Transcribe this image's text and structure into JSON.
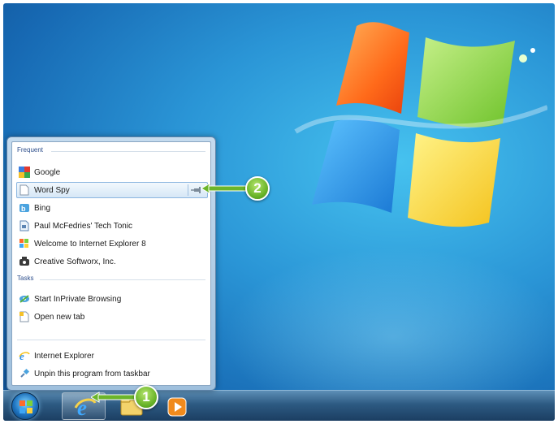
{
  "jumplist": {
    "frequent_header": "Frequent",
    "frequent": [
      {
        "label": "Google",
        "icon": "google-icon"
      },
      {
        "label": "Word Spy",
        "icon": "page-icon",
        "hovered": true
      },
      {
        "label": "Bing",
        "icon": "bing-icon"
      },
      {
        "label": "Paul McFedries' Tech Tonic",
        "icon": "page-icon"
      },
      {
        "label": "Welcome to Internet Explorer 8",
        "icon": "windows-flag-icon"
      },
      {
        "label": "Creative Softworx, Inc.",
        "icon": "creative-softworx-icon"
      }
    ],
    "tasks_header": "Tasks",
    "tasks": [
      {
        "label": "Start InPrivate Browsing",
        "icon": "inprivate-icon"
      },
      {
        "label": "Open new tab",
        "icon": "new-tab-icon"
      }
    ],
    "program": [
      {
        "label": "Internet Explorer",
        "icon": "ie-icon"
      },
      {
        "label": "Unpin this program from taskbar",
        "icon": "unpin-icon"
      }
    ]
  },
  "callouts": {
    "one": "1",
    "two": "2"
  },
  "colors": {
    "callout_green": "#6bb52a",
    "desktop_blue": "#2a95d6",
    "taskbar": "#2d5a82"
  }
}
